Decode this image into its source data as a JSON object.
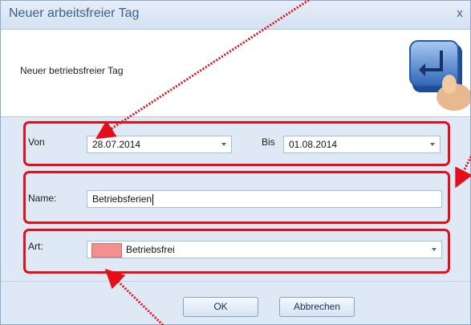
{
  "window": {
    "title": "Neuer arbeitsfreier Tag",
    "close_glyph": "x"
  },
  "header": {
    "text": "Neuer betriebsfreier Tag",
    "icon": "keyboard-enter-key-icon"
  },
  "form": {
    "from_label": "Von",
    "from_value": "28.07.2014",
    "to_label": "Bis",
    "to_value": "01.08.2014",
    "name_label": "Name:",
    "name_value": "Betriebsferien",
    "type_label": "Art:",
    "type_value": "Betriebsfrei",
    "type_color": "#f48f8f"
  },
  "buttons": {
    "ok": "OK",
    "cancel": "Abbrechen"
  },
  "colors": {
    "highlight": "#e3101c",
    "accent": "#3b5f8f"
  }
}
